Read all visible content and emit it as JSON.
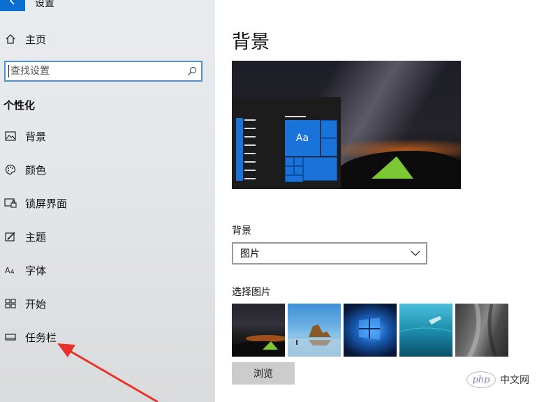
{
  "window": {
    "title": "设置",
    "back_icon": "back-arrow-icon"
  },
  "sidebar": {
    "home": {
      "label": "主页",
      "icon": "home-icon"
    },
    "search": {
      "placeholder": "查找设置",
      "value": "",
      "icon": "search-icon"
    },
    "section_heading": "个性化",
    "items": [
      {
        "label": "背景",
        "icon": "picture-icon"
      },
      {
        "label": "颜色",
        "icon": "palette-icon"
      },
      {
        "label": "锁屏界面",
        "icon": "lock-screen-icon"
      },
      {
        "label": "主题",
        "icon": "theme-icon"
      },
      {
        "label": "字体",
        "icon": "font-icon"
      },
      {
        "label": "开始",
        "icon": "start-icon"
      },
      {
        "label": "任务栏",
        "icon": "taskbar-icon"
      }
    ]
  },
  "main": {
    "title": "背景",
    "preview": {
      "tile_text": "Aa"
    },
    "background_label": "背景",
    "background_select": {
      "value": "图片",
      "icon": "chevron-down-icon"
    },
    "choose_picture_label": "选择图片",
    "thumbnails": [
      "thumb-night-tent",
      "thumb-beach-rocks",
      "thumb-windows-blue",
      "thumb-underwater",
      "thumb-rock-cliff"
    ],
    "browse_button": "浏览"
  },
  "watermark": {
    "logo": "php",
    "text": "中文网"
  },
  "colors": {
    "accent": "#0a6fd1",
    "tile_blue": "#1a73d8",
    "annotation_red": "#e8332a"
  }
}
